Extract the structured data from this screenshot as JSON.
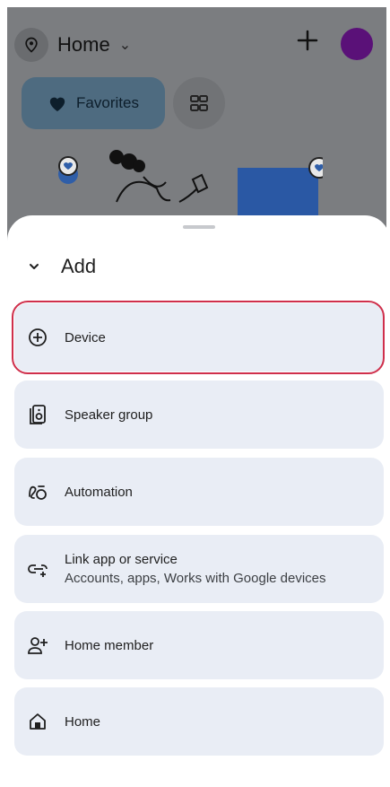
{
  "background": {
    "home_title": "Home",
    "favorites_label": "Favorites",
    "avatar_color": "#5a1178",
    "icons": [
      "home-logo-icon",
      "chevron-down-icon",
      "plus-icon",
      "heart-icon",
      "grid-icon"
    ]
  },
  "sheet": {
    "title": "Add",
    "options": [
      {
        "label": "Device",
        "icon": "add-circle-icon",
        "selected": true
      },
      {
        "label": "Speaker group",
        "icon": "speaker-icon"
      },
      {
        "label": "Automation",
        "icon": "automation-icon"
      },
      {
        "label": "Link app or service",
        "sublabel": "Accounts, apps, Works with Google devices",
        "icon": "link-icon"
      },
      {
        "label": "Home member",
        "icon": "person-add-icon"
      },
      {
        "label": "Home",
        "icon": "home-icon"
      }
    ]
  },
  "colors": {
    "selection_outline": "#cf2f4b",
    "option_bg": "#e9edf5",
    "favorites_bg": "#4e6b80"
  }
}
